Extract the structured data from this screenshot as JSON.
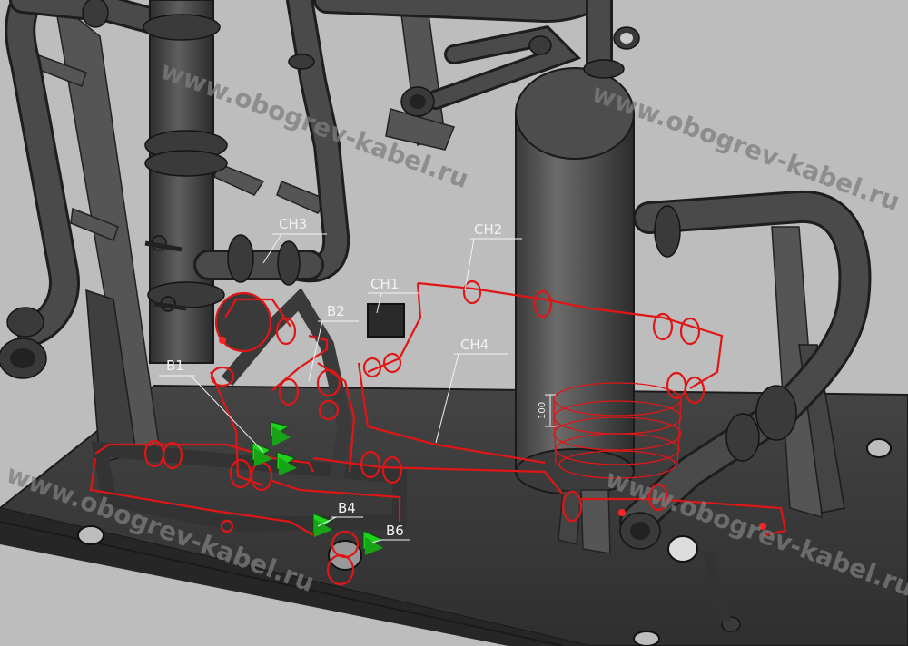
{
  "drawing": {
    "watermark": "www.obogrev-kabel.ru",
    "dimension_label": "100",
    "labels": {
      "ch1": "CH1",
      "ch2": "CH2",
      "ch3": "CH3",
      "ch4": "CH4",
      "b1": "B1",
      "b2": "B2",
      "b4": "B4",
      "b6": "B6"
    },
    "colors": {
      "background": "#bdbdbd",
      "steel": "#4a4a4a",
      "heating_cable": "#e01616",
      "valve_marker": "#1ed21e",
      "callout_text": "#f2f2f2"
    }
  }
}
